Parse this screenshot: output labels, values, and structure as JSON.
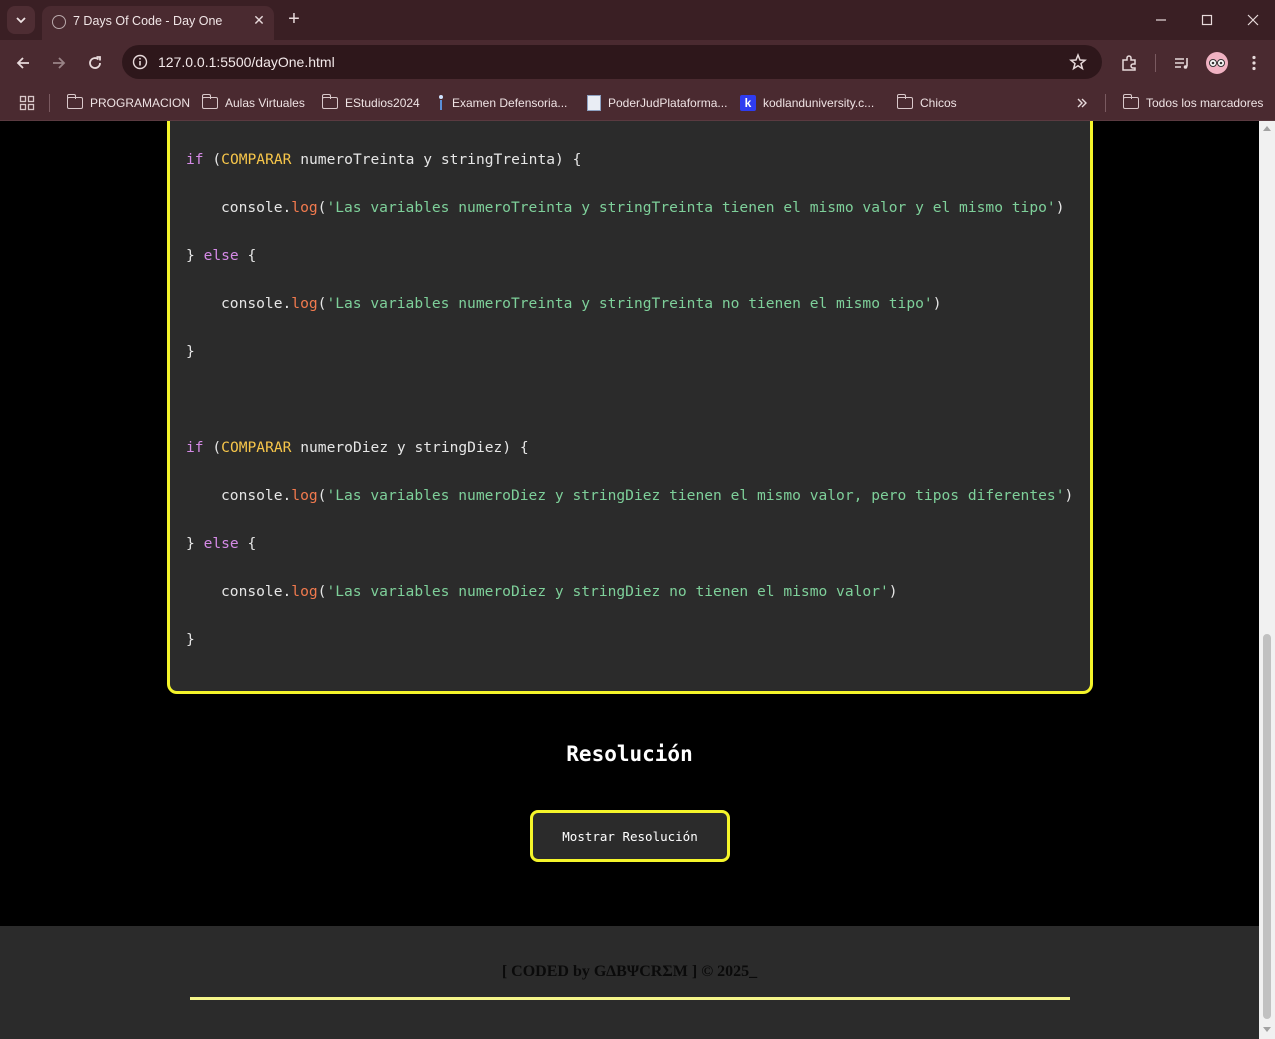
{
  "browser": {
    "tab_title": "7 Days Of Code - Day One",
    "url": "127.0.0.1:5500/dayOne.html",
    "bookmarks": [
      {
        "label": "PROGRAMACION",
        "icon": "folder-icon"
      },
      {
        "label": "Aulas Virtuales",
        "icon": "folder-icon"
      },
      {
        "label": "EStudios2024",
        "icon": "folder-icon"
      },
      {
        "label": "Examen Defensoria...",
        "icon": "pin-icon"
      },
      {
        "label": "PoderJudPlataforma...",
        "icon": "poderjud-icon"
      },
      {
        "label": "kodlanduniversity.c...",
        "icon": "kodland-icon"
      },
      {
        "label": "Chicos",
        "icon": "folder-icon"
      }
    ],
    "all_bookmarks_label": "Todos los marcadores"
  },
  "code": {
    "block1": {
      "if_kw": "if",
      "open_paren": " (",
      "compare": "COMPARAR",
      "condition": " numeroTreinta y stringTreinta) {",
      "log1_obj": "console.",
      "log1_fn": "log",
      "log1_open": "(",
      "log1_str": "'Las variables numeroTreinta y stringTreinta tienen el mismo valor y el mismo tipo'",
      "log1_close": ")",
      "else_open": "} ",
      "else_kw": "else",
      "else_brace": " {",
      "log2_obj": "console.",
      "log2_fn": "log",
      "log2_open": "(",
      "log2_str": "'Las variables numeroTreinta y stringTreinta no tienen el mismo tipo'",
      "log2_close": ")",
      "close": "}"
    },
    "block2": {
      "if_kw": "if",
      "open_paren": " (",
      "compare": "COMPARAR",
      "condition": " numeroDiez y stringDiez) {",
      "log1_obj": "console.",
      "log1_fn": "log",
      "log1_open": "(",
      "log1_str": "'Las variables numeroDiez y stringDiez tienen el mismo valor, pero tipos diferentes'",
      "log1_close": ")",
      "else_open": "} ",
      "else_kw": "else",
      "else_brace": " {",
      "log2_obj": "console.",
      "log2_fn": "log",
      "log2_open": "(",
      "log2_str": "'Las variables numeroDiez y stringDiez no tienen el mismo valor'",
      "log2_close": ")",
      "close": "}"
    }
  },
  "resolution": {
    "title": "Resolución",
    "button_label": "Mostrar Resolución"
  },
  "footer": {
    "text": "[ CODED by G∆BΨCRΣM ] © 2025_"
  },
  "colors": {
    "accent_yellow": "#f5f52a",
    "card_bg": "#2b2b2b",
    "keyword": "#d58ae6",
    "compare": "#f7c64a",
    "function": "#f27a4e",
    "string": "#7ed09a"
  }
}
